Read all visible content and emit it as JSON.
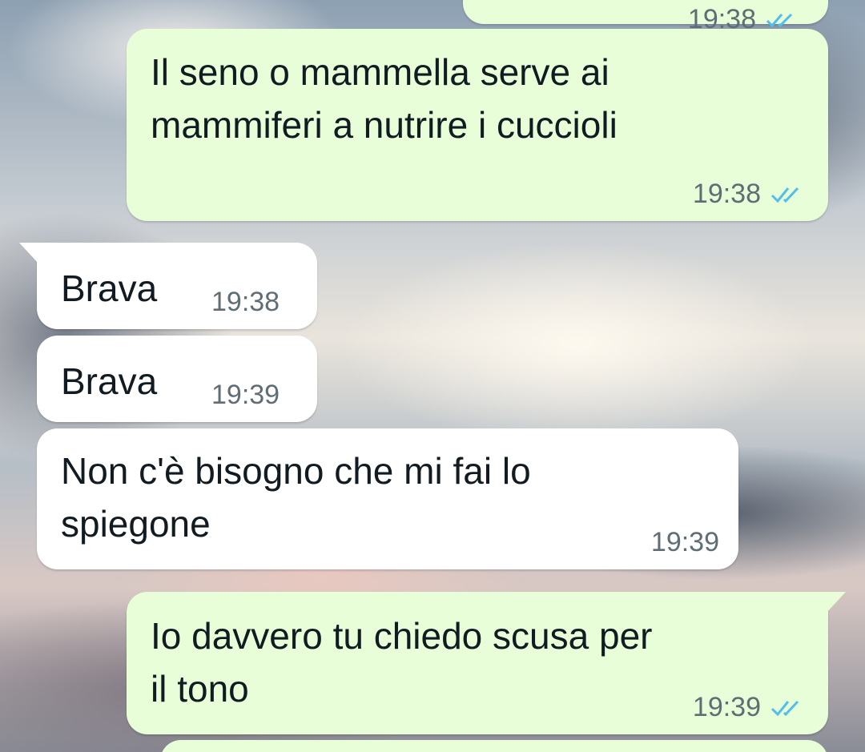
{
  "colors": {
    "outgoing_bubble": "#e7fed8",
    "incoming_bubble": "#ffffff",
    "read_check": "#53bdeb",
    "timestamp": "#5f6d74"
  },
  "messages": [
    {
      "direction": "outgoing",
      "text": "",
      "time": "19:38",
      "status_icon": "double-check-read-icon",
      "partial": true
    },
    {
      "direction": "outgoing",
      "text": "Il seno o mammella serve ai\nmammiferi a nutrire i cuccioli",
      "time": "19:38",
      "status_icon": "double-check-read-icon"
    },
    {
      "direction": "incoming",
      "text": "Brava",
      "time": "19:38"
    },
    {
      "direction": "incoming",
      "text": "Brava",
      "time": "19:39"
    },
    {
      "direction": "incoming",
      "text": "Non c'è bisogno che mi fai lo\nspiegone",
      "time": "19:39"
    },
    {
      "direction": "outgoing",
      "text": "Io davvero tu chiedo scusa per\nil tono",
      "time": "19:39",
      "status_icon": "double-check-read-icon"
    },
    {
      "direction": "outgoing",
      "text": "",
      "partial": true
    }
  ]
}
